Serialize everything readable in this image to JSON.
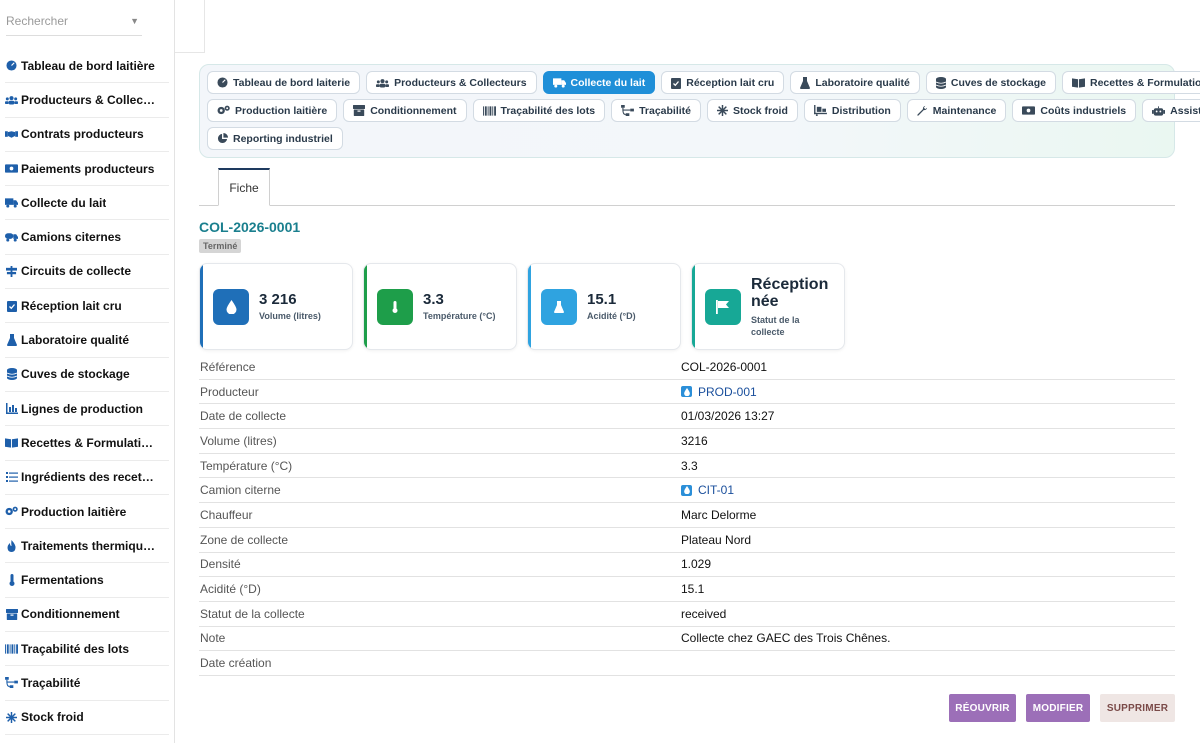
{
  "search": {
    "placeholder": "Rechercher"
  },
  "sidebar": {
    "items": [
      {
        "label": "Tableau de bord laitière",
        "icon": "gauge-icon"
      },
      {
        "label": "Producteurs & Collecteurs",
        "icon": "users-icon"
      },
      {
        "label": "Contrats producteurs",
        "icon": "handshake-icon"
      },
      {
        "label": "Paiements producteurs",
        "icon": "money-icon"
      },
      {
        "label": "Collecte du lait",
        "icon": "truck-icon"
      },
      {
        "label": "Camions citernes",
        "icon": "tanker-icon"
      },
      {
        "label": "Circuits de collecte",
        "icon": "signs-icon"
      },
      {
        "label": "Réception lait cru",
        "icon": "clipboard-check-icon"
      },
      {
        "label": "Laboratoire qualité",
        "icon": "flask-icon"
      },
      {
        "label": "Cuves de stockage",
        "icon": "database-icon"
      },
      {
        "label": "Lignes de production",
        "icon": "chart-icon"
      },
      {
        "label": "Recettes & Formulations",
        "icon": "book-icon"
      },
      {
        "label": "Ingrédients des recettes",
        "icon": "list-icon"
      },
      {
        "label": "Production laitière",
        "icon": "gears-icon"
      },
      {
        "label": "Traitements thermiques",
        "icon": "fire-icon"
      },
      {
        "label": "Fermentations",
        "icon": "thermometer-icon"
      },
      {
        "label": "Conditionnement",
        "icon": "box-icon"
      },
      {
        "label": "Traçabilité des lots",
        "icon": "barcode-icon"
      },
      {
        "label": "Traçabilité",
        "icon": "sitemap-icon"
      },
      {
        "label": "Stock froid",
        "icon": "snowflake-icon"
      }
    ]
  },
  "nav": {
    "rows": [
      [
        {
          "label": "Tableau de bord laiterie",
          "icon": "gauge-icon"
        },
        {
          "label": "Producteurs & Collecteurs",
          "icon": "users-icon"
        },
        {
          "label": "Collecte du lait",
          "icon": "truck-icon",
          "active": true
        },
        {
          "label": "Réception lait cru",
          "icon": "clipboard-check-icon"
        },
        {
          "label": "Laboratoire qualité",
          "icon": "flask-icon"
        },
        {
          "label": "Cuves de stockage",
          "icon": "database-icon"
        },
        {
          "label": "Recettes & Formulations",
          "icon": "book-icon"
        }
      ],
      [
        {
          "label": "Production laitière",
          "icon": "gears-icon"
        },
        {
          "label": "Conditionnement",
          "icon": "box-icon"
        },
        {
          "label": "Traçabilité des lots",
          "icon": "barcode-icon"
        },
        {
          "label": "Traçabilité",
          "icon": "sitemap-icon"
        },
        {
          "label": "Stock froid",
          "icon": "snowflake-icon"
        },
        {
          "label": "Distribution",
          "icon": "dolly-icon"
        },
        {
          "label": "Maintenance",
          "icon": "wrench-icon"
        },
        {
          "label": "Coûts industriels",
          "icon": "money-icon"
        },
        {
          "label": "Assistant IA",
          "icon": "robot-icon"
        }
      ],
      [
        {
          "label": "Reporting industriel",
          "icon": "pie-icon"
        }
      ]
    ]
  },
  "tabs": {
    "fiche": "Fiche"
  },
  "record": {
    "title": "COL-2026-0001",
    "status_badge": "Terminé"
  },
  "cards": [
    {
      "value": "3 216",
      "label": "Volume (litres)",
      "icon": "droplet-icon",
      "color": "#1f6fb8"
    },
    {
      "value": "3.3",
      "label": "Température (°C)",
      "icon": "thermometer-icon",
      "color": "#1e9e4a"
    },
    {
      "value": "15.1",
      "label": "Acidité (°D)",
      "icon": "flask-icon",
      "color": "#2fa3e0"
    },
    {
      "value": "Réception née",
      "label": "Statut de la collecte",
      "icon": "flag-icon",
      "color": "#17a896"
    }
  ],
  "details": [
    {
      "label": "Référence",
      "value": "COL-2026-0001"
    },
    {
      "label": "Producteur",
      "value": "PROD-001",
      "link": true
    },
    {
      "label": "Date de collecte",
      "value": "01/03/2026 13:27"
    },
    {
      "label": "Volume (litres)",
      "value": "3216"
    },
    {
      "label": "Température (°C)",
      "value": "3.3"
    },
    {
      "label": "Camion citerne",
      "value": "CIT-01",
      "link": true
    },
    {
      "label": "Chauffeur",
      "value": "Marc Delorme"
    },
    {
      "label": "Zone de collecte",
      "value": "Plateau Nord"
    },
    {
      "label": "Densité",
      "value": "1.029"
    },
    {
      "label": "Acidité (°D)",
      "value": "15.1"
    },
    {
      "label": "Statut de la collecte",
      "value": "received"
    },
    {
      "label": "Note",
      "value": "Collecte chez GAEC des Trois Chênes."
    },
    {
      "label": "Date création",
      "value": ""
    }
  ],
  "actions": {
    "reopen": "RÉOUVRIR",
    "edit": "MODIFIER",
    "delete": "SUPPRIMER"
  }
}
